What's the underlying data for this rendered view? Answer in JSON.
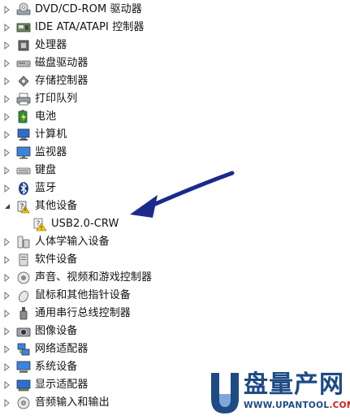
{
  "tree": {
    "items": [
      {
        "label": "DVD/CD-ROM 驱动器",
        "icon": "dvd-drive-icon",
        "expanded": false
      },
      {
        "label": "IDE ATA/ATAPI 控制器",
        "icon": "ide-controller-icon",
        "expanded": false
      },
      {
        "label": "处理器",
        "icon": "processor-icon",
        "expanded": false
      },
      {
        "label": "磁盘驱动器",
        "icon": "disk-drive-icon",
        "expanded": false
      },
      {
        "label": "存储控制器",
        "icon": "storage-controller-icon",
        "expanded": false
      },
      {
        "label": "打印队列",
        "icon": "printer-icon",
        "expanded": false
      },
      {
        "label": "电池",
        "icon": "battery-icon",
        "expanded": false
      },
      {
        "label": "计算机",
        "icon": "computer-icon",
        "expanded": false
      },
      {
        "label": "监视器",
        "icon": "monitor-icon",
        "expanded": false
      },
      {
        "label": "键盘",
        "icon": "keyboard-icon",
        "expanded": false
      },
      {
        "label": "蓝牙",
        "icon": "bluetooth-icon",
        "expanded": false
      },
      {
        "label": "其他设备",
        "icon": "other-devices-icon",
        "expanded": true
      },
      {
        "label": "USB2.0-CRW",
        "icon": "unknown-device-warning-icon",
        "child": true
      },
      {
        "label": "人体学输入设备",
        "icon": "hid-icon",
        "expanded": false
      },
      {
        "label": "软件设备",
        "icon": "software-device-icon",
        "expanded": false
      },
      {
        "label": "声音、视频和游戏控制器",
        "icon": "sound-icon",
        "expanded": false
      },
      {
        "label": "鼠标和其他指针设备",
        "icon": "mouse-icon",
        "expanded": false
      },
      {
        "label": "通用串行总线控制器",
        "icon": "usb-icon",
        "expanded": false
      },
      {
        "label": "图像设备",
        "icon": "camera-icon",
        "expanded": false
      },
      {
        "label": "网络适配器",
        "icon": "network-adapter-icon",
        "expanded": false
      },
      {
        "label": "系统设备",
        "icon": "system-device-icon",
        "expanded": false
      },
      {
        "label": "显示适配器",
        "icon": "display-adapter-icon",
        "expanded": false
      },
      {
        "label": "音频输入和输出",
        "icon": "audio-io-icon",
        "expanded": false
      }
    ]
  },
  "watermark": {
    "brand": "盘量产网",
    "url_prefix": "WWW.",
    "url_main": "UPANTOOL",
    "url_suffix": ".COM"
  },
  "colors": {
    "text": "#111111",
    "arrow": "#1a2a8c",
    "watermark_blue": "#1e4a86",
    "watermark_red": "#d01e1e"
  }
}
